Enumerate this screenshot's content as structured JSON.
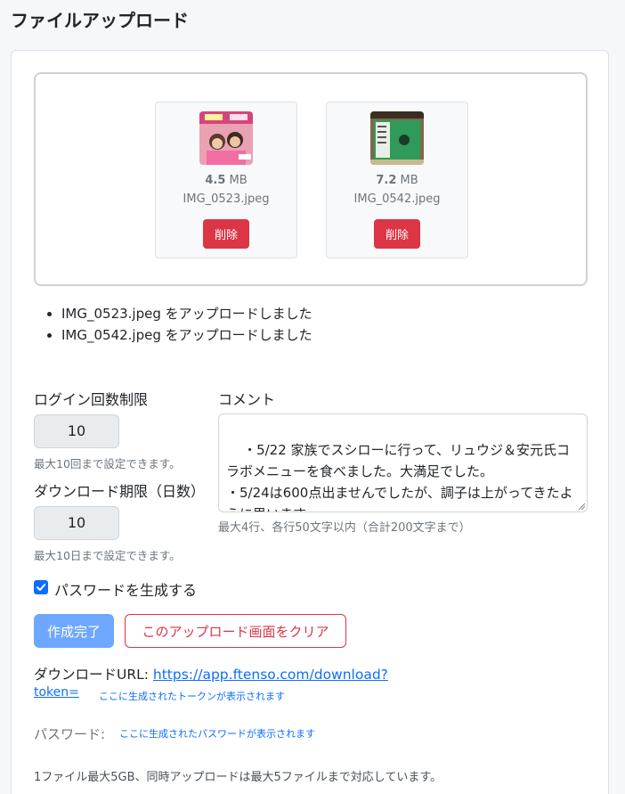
{
  "page_title": "ファイルアップロード",
  "files": [
    {
      "size_value": "4.5",
      "size_unit": "MB",
      "name": "IMG_0523.jpeg",
      "delete_label": "削除"
    },
    {
      "size_value": "7.2",
      "size_unit": "MB",
      "name": "IMG_0542.jpeg",
      "delete_label": "削除"
    }
  ],
  "upload_log": [
    "IMG_0523.jpeg をアップロードしました",
    "IMG_0542.jpeg をアップロードしました"
  ],
  "login_limit": {
    "label": "ログイン回数制限",
    "value": "10",
    "hint": "最大10回まで設定できます。"
  },
  "download_limit": {
    "label": "ダウンロード期限（日数）",
    "value": "10",
    "hint": "最大10日まで設定できます。"
  },
  "comment": {
    "label": "コメント",
    "value": "・5/22 家族でスシローに行って、リュウジ＆安元氏コラボメニューを食べました。大満足でした。\n・5/24は600点出ませんでしたが、調子は上がってきたように思います。",
    "hint": "最大4行、各行50文字以内（合計200文字まで）"
  },
  "generate_password": {
    "label": "パスワードを生成する",
    "checked": true
  },
  "buttons": {
    "complete": "作成完了",
    "clear": "このアップロード画面をクリア"
  },
  "download_url": {
    "label": "ダウンロードURL: ",
    "url_part1": "https://app.ftenso.com/download?",
    "url_part2": "token=",
    "token_placeholder": "ここに生成されたトークンが表示されます"
  },
  "password": {
    "label": "パスワード:",
    "placeholder": "ここに生成されたパスワードが表示されます"
  },
  "footer_note": "1ファイル最大5GB、同時アップロードは最大5ファイルまで対応しています。",
  "colors": {
    "danger": "#dc3545",
    "primary": "#0d6efd",
    "primary_disabled": "#6ea8fe"
  }
}
